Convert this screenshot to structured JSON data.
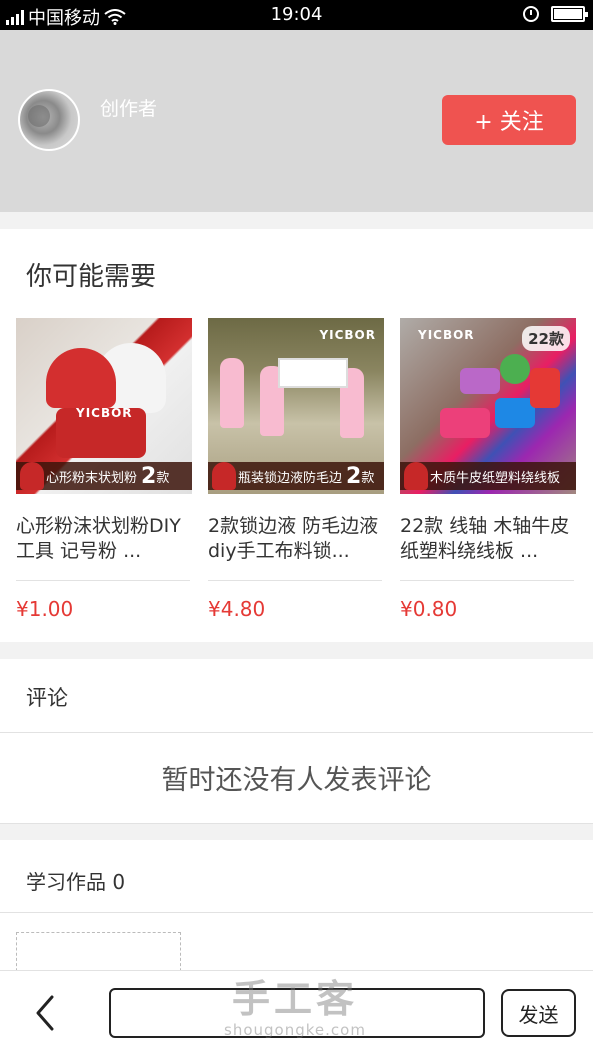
{
  "status_bar": {
    "carrier": "中国移动",
    "time": "19:04"
  },
  "author": {
    "name": "创作者",
    "follow_label": "+ 关注"
  },
  "recommend": {
    "title": "你可能需要",
    "products": [
      {
        "name": "心形粉沫状划粉DIY工具 记号粉 ...",
        "price": "¥1.00",
        "banner_text": "心形粉末状划粉",
        "banner_num": "2",
        "banner_suffix": "款",
        "brand": "YICBOR"
      },
      {
        "name": "2款锁边液 防毛边液 diy手工布料锁...",
        "price": "¥4.80",
        "banner_text": "瓶装锁边液防毛边",
        "banner_num": "2",
        "banner_suffix": "款",
        "brand": "YICBOR"
      },
      {
        "name": "22款 线轴 木轴牛皮纸塑料绕线板 ...",
        "price": "¥0.80",
        "banner_text": "木质牛皮纸塑料绕线板",
        "corner": "22款",
        "brand": "YICBOR"
      }
    ]
  },
  "comments": {
    "title": "评论",
    "empty_text": "暂时还没有人发表评论"
  },
  "works": {
    "title": "学习作品 0"
  },
  "bottom_bar": {
    "input_value": "",
    "send_label": "发送"
  },
  "watermark": {
    "big": "手工客",
    "small": "shougongke.com"
  },
  "colors": {
    "accent": "#ef5350",
    "price": "#e53935",
    "header_bg": "#d9d9d9"
  }
}
